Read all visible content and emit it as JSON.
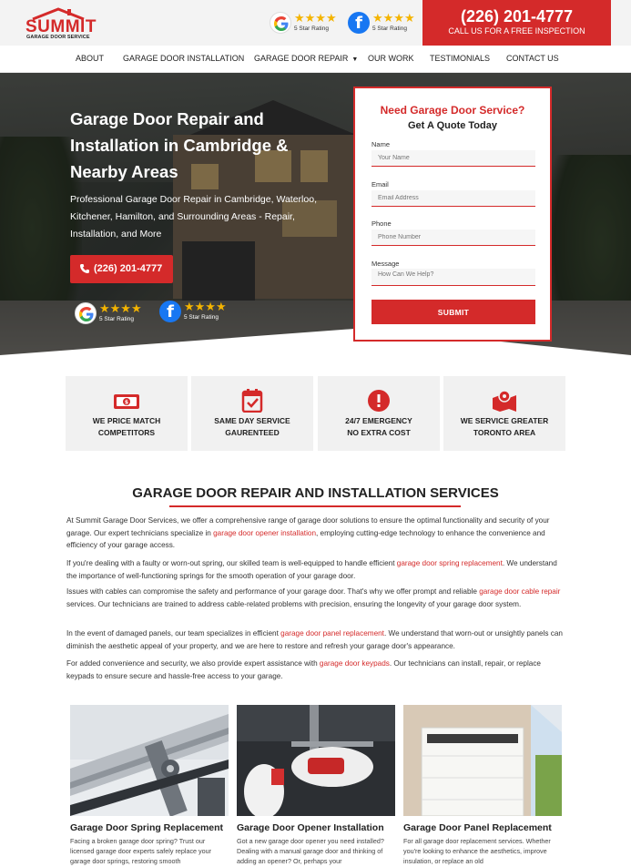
{
  "brand": {
    "name": "SUMMIT",
    "tagline": "GARAGE DOOR SERVICE",
    "red": "#d42a2a"
  },
  "header": {
    "google_rating": {
      "stars": "★★★★",
      "label": "5 Star Rating",
      "icon": "google-icon"
    },
    "facebook_rating": {
      "stars": "★★★★",
      "label": "5 Star Rating",
      "icon": "facebook-icon"
    },
    "phone": "(226) 201-4777",
    "phone_cta": "CALL US FOR A FREE INSPECTION"
  },
  "nav": {
    "items": [
      {
        "label": "ABOUT"
      },
      {
        "label": "GARAGE DOOR INSTALLATION"
      },
      {
        "label": "GARAGE DOOR REPAIR"
      },
      {
        "label": "OUR WORK"
      },
      {
        "label": "TESTIMONIALS"
      },
      {
        "label": "CONTACT US"
      }
    ]
  },
  "hero": {
    "title": "Garage Door Repair and Installation in Cambridge & Nearby Areas",
    "description": "Professional Garage Door Repair in Cambridge, Waterloo, Kitchener, Hamilton, and Surrounding Areas - Repair, Installation, and More",
    "call_label": "(226) 201-4777",
    "google_rating": {
      "stars": "★★★★",
      "label": "5 Star Rating"
    },
    "facebook_rating": {
      "stars": "★★★★",
      "label": "5 Star Rating"
    }
  },
  "quote_form": {
    "title": "Need Garage Door Service?",
    "subtitle": "Get A Quote Today",
    "fields": [
      {
        "label": "Name",
        "placeholder": "Your Name"
      },
      {
        "label": "Email",
        "placeholder": "Email Address"
      },
      {
        "label": "Phone",
        "placeholder": "Phone Number"
      },
      {
        "label": "Message",
        "placeholder": "How Can We Help?"
      }
    ],
    "submit_label": "SUBMIT"
  },
  "features": [
    {
      "label": "WE PRICE MATCH\nCOMPETITORS",
      "icon": "money-icon"
    },
    {
      "label": "SAME DAY SERVICE\nGAURENTEED",
      "icon": "calendar-check-icon"
    },
    {
      "label": "24/7 EMERGENCY\nNO EXTRA COST",
      "icon": "alert-icon"
    },
    {
      "label": "WE SERVICE GREATER\nTORONTO AREA",
      "icon": "map-pin-icon"
    }
  ],
  "services": {
    "title": "GARAGE DOOR REPAIR AND INSTALLATION SERVICES",
    "paragraphs": [
      {
        "before": "At Summit Garage Door Services, we offer a comprehensive range of garage door solutions to ensure the optimal functionality and security of your garage. Our expert technicians specialize in ",
        "link": "garage door opener installation",
        "after": ", employing cutting-edge technology to enhance the convenience and efficiency of your garage access."
      },
      {
        "before": "If you're dealing with a faulty or worn-out spring, our skilled team is well-equipped to handle efficient ",
        "link": "garage door spring replacement",
        "after": ". We understand the importance of well-functioning springs for the smooth operation of your garage door."
      },
      {
        "before": "Issues with cables can compromise the safety and performance of your garage door. That's why we offer prompt and reliable ",
        "link": "garage door cable repair",
        "after": " services. Our technicians are trained to address cable-related problems with precision, ensuring the longevity of your garage door system."
      },
      {
        "before": "In the event of damaged panels, our team specializes in efficient ",
        "link": "garage door panel replacement",
        "after": ". We understand that worn-out or unsightly panels can diminish the aesthetic appeal of your property, and we are here to restore and refresh your garage door's appearance."
      },
      {
        "before": "For added convenience and security, we also provide expert assistance with ",
        "link": "garage door keypads",
        "after": ". Our technicians can install, repair, or replace keypads to ensure secure and hassle-free access to your garage."
      }
    ],
    "cards": [
      {
        "title": "Garage Door Spring Replacement",
        "desc": "Facing a broken garage door spring? Trust our licensed garage door experts safely replace your garage door springs, restoring smooth"
      },
      {
        "title": "Garage Door Opener Installation",
        "desc": "Got a new garage door opener you need installed? Dealing with a manual garage door and thinking of adding an opener? Or, perhaps your"
      },
      {
        "title": "Garage Door Panel Replacement",
        "desc": "For all garage door replacement services. Whether you're looking to enhance the aesthetics, improve insulation, or replace an old"
      }
    ]
  }
}
